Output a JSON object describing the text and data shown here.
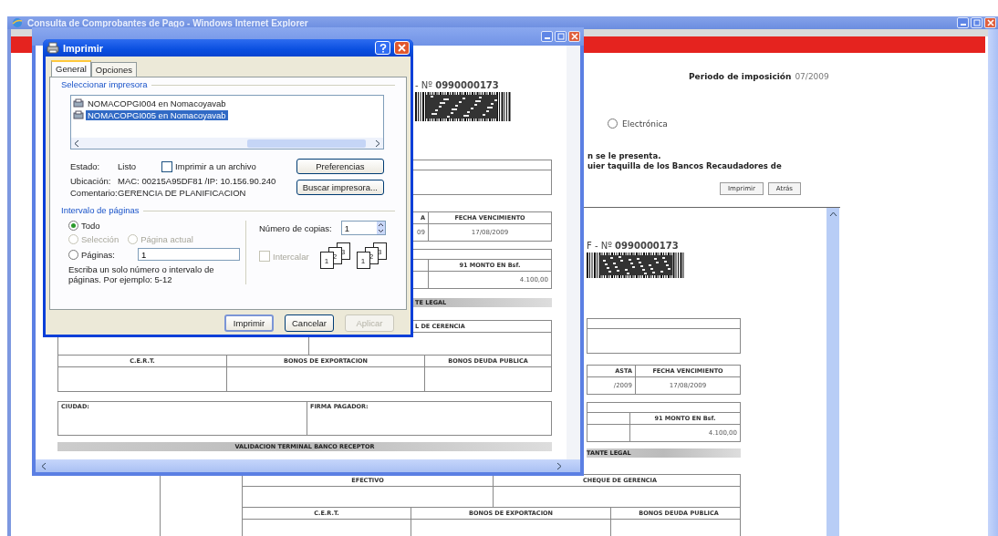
{
  "browser": {
    "title": "Consulta de Comprobantes de Pago - Windows Internet Explorer"
  },
  "page": {
    "period_label": "Periodo de imposición",
    "period_value": "07/2009",
    "payment_option": {
      "label": "Electrónica",
      "selected": false
    },
    "notice_lines": [
      "n se le presenta.",
      "uier taquilla de los Bancos Recaudadores de"
    ],
    "buttons": [
      "Imprimir",
      "Atrás"
    ]
  },
  "frame": {
    "document_number": "F - Nº **0990000173**",
    "dates": {
      "columns": [
        "ASTA",
        "FECHA VENCIMIENTO"
      ],
      "values": [
        "/2009",
        "17/08/2009"
      ]
    },
    "amount": {
      "label": "91 MONTO EN Bsf.",
      "value": "4.100,00"
    },
    "section": "TANTE LEGAL",
    "payment_columns": [
      "EFECTIVO",
      "CHEQUE DE GERENCIA"
    ],
    "bond_columns": [
      "C.E.R.T.",
      "BONOS DE EXPORTACION",
      "BONOS DEUDA PUBLICA"
    ]
  },
  "popup": {
    "document_number": "- Nº **0990000173**",
    "dates": {
      "columns": [
        "A",
        "FECHA VENCIMIENTO"
      ],
      "values": [
        "09",
        "17/08/2009"
      ]
    },
    "amount": {
      "label": "91 MONTO EN Bsf.",
      "value": "4.100,00"
    },
    "section": "TE LEGAL",
    "payment_column": "L DE CERENCIA",
    "bond_columns": [
      "C.E.R.T.",
      "BONOS DE EXPORTACION",
      "BONOS DEUDA PUBLICA"
    ],
    "signature_columns": [
      "CIUDAD:",
      "FIRMA PAGADOR:"
    ],
    "validation": "VALIDACION TERMINAL BANCO RECEPTOR"
  },
  "print_dialog": {
    "title": "Imprimir",
    "tabs": [
      {
        "label": "General",
        "selected": true
      },
      {
        "label": "Opciones",
        "selected": false
      }
    ],
    "printer_group": "Seleccionar impresora",
    "printers": [
      {
        "name": "NOMACOPGI004 en Nomacoyavab",
        "selected": false
      },
      {
        "name": "NOMACOPGI005 en Nomacoyavab",
        "selected": true
      }
    ],
    "status_label": "Estado:",
    "status": "Listo",
    "print_to_file": {
      "label": "Imprimir a un archivo",
      "checked": false
    },
    "preferences_button": "Preferencias",
    "location_label": "Ubicación:",
    "location": "MAC: 00215A95DF81 /IP: 10.156.90.240",
    "comment_label": "Comentario:",
    "comment": "GERENCIA DE PLANIFICACION",
    "find_button": "Buscar impresora...",
    "range_group": "Intervalo de páginas",
    "range_options": [
      {
        "label": "Todo",
        "selected": true,
        "disabled": false
      },
      {
        "label": "Selección",
        "selected": false,
        "disabled": true
      },
      {
        "label": "Página actual",
        "selected": false,
        "disabled": true
      },
      {
        "label": "Páginas:",
        "selected": false,
        "disabled": false
      }
    ],
    "pages_value": "1",
    "range_hint": "Escriba un solo número o intervalo de páginas. Por ejemplo: 5-12",
    "copies_label": "Número de copias:",
    "copies": "1",
    "collate": {
      "label": "Intercalar",
      "checked": false,
      "disabled": true
    },
    "collate_icons": [
      [
        "1",
        "2",
        "3"
      ],
      [
        "1",
        "2",
        "3"
      ]
    ],
    "buttons": [
      {
        "label": "Imprimir",
        "disabled": false
      },
      {
        "label": "Cancelar",
        "disabled": false
      },
      {
        "label": "Aplicar",
        "disabled": true
      }
    ]
  }
}
